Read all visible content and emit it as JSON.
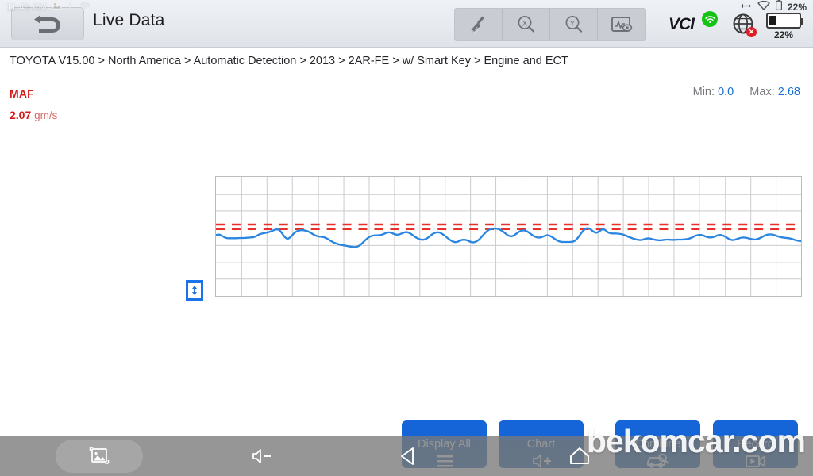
{
  "status_bar": {
    "time": "11:40 AM",
    "icons": [
      "image-icon",
      "upload-icon",
      "wifi-unknown-icon"
    ],
    "right_icons": [
      "bluetooth-transfer-icon",
      "wifi-icon",
      "battery-small-icon"
    ],
    "battery_percent_top": "22%",
    "battery_percent_bottom": "22%"
  },
  "header": {
    "title": "Live Data",
    "back_label": "back-arrow",
    "tools": [
      {
        "name": "clear-graph-icon",
        "label": "Clear"
      },
      {
        "name": "zoom-x-icon",
        "label": "X"
      },
      {
        "name": "zoom-y-icon",
        "label": "Y"
      },
      {
        "name": "graph-view-icon",
        "label": "View"
      }
    ],
    "vci_label": "VCI",
    "vci_status": "connected",
    "network_status": "disconnected"
  },
  "breadcrumb": {
    "text": "TOYOTA V15.00 > North America  > Automatic Detection  > 2013  > 2AR-FE  > w/ Smart Key  > Engine and ECT",
    "segments": [
      "TOYOTA V15.00",
      "North America",
      "Automatic Detection",
      "2013",
      "2AR-FE",
      "w/ Smart Key",
      "Engine and ECT"
    ]
  },
  "live_data": {
    "parameter_name": "MAF",
    "current_value": "2.07",
    "unit": "gm/s",
    "min_label": "Min",
    "min_value": "0.0",
    "max_label": "Max",
    "max_value": "2.68",
    "separator": ":"
  },
  "colors": {
    "parameter_red": "#d21b1b",
    "trace_blue": "#2a86e0",
    "limit_red": "#e8302b",
    "minmax_blue": "#1a6fd4",
    "button_blue": "#1565d8",
    "vci_green": "#16c216"
  },
  "chart_data": {
    "type": "line",
    "title": "MAF",
    "xlabel": "",
    "ylabel": "gm/s",
    "ylim": [
      0,
      4.5
    ],
    "grid": true,
    "legend": "none",
    "grid_cols": 23,
    "grid_rows": 7,
    "annotations": [
      {
        "type": "hline",
        "value": 2.7,
        "style": "dashed",
        "color": "#e8302b",
        "label": "upper-limit"
      },
      {
        "type": "hline",
        "value": 2.53,
        "style": "dashed",
        "color": "#e8302b",
        "label": "lower-limit"
      }
    ],
    "series": [
      {
        "name": "MAF",
        "color": "#2a86e0",
        "values": [
          2.3,
          2.33,
          2.28,
          2.21,
          2.18,
          2.18,
          2.18,
          2.18,
          2.19,
          2.19,
          2.19,
          2.2,
          2.21,
          2.22,
          2.26,
          2.33,
          2.36,
          2.38,
          2.4,
          2.44,
          2.48,
          2.52,
          2.5,
          2.36,
          2.2,
          2.15,
          2.24,
          2.36,
          2.45,
          2.48,
          2.49,
          2.47,
          2.44,
          2.38,
          2.31,
          2.26,
          2.24,
          2.23,
          2.2,
          2.14,
          2.07,
          2.01,
          1.97,
          1.94,
          1.92,
          1.9,
          1.88,
          1.86,
          1.85,
          1.86,
          1.92,
          2.02,
          2.13,
          2.22,
          2.27,
          2.29,
          2.29,
          2.3,
          2.33,
          2.38,
          2.41,
          2.38,
          2.33,
          2.31,
          2.34,
          2.39,
          2.42,
          2.39,
          2.32,
          2.24,
          2.17,
          2.13,
          2.12,
          2.16,
          2.24,
          2.33,
          2.39,
          2.41,
          2.38,
          2.31,
          2.22,
          2.13,
          2.06,
          2.03,
          2.05,
          2.11,
          2.13,
          2.11,
          2.06,
          2.02,
          2.04,
          2.1,
          2.21,
          2.34,
          2.45,
          2.52,
          2.55,
          2.55,
          2.53,
          2.48,
          2.4,
          2.31,
          2.25,
          2.26,
          2.33,
          2.42,
          2.47,
          2.48,
          2.44,
          2.36,
          2.28,
          2.22,
          2.2,
          2.22,
          2.27,
          2.3,
          2.27,
          2.2,
          2.12,
          2.06,
          2.04,
          2.04,
          2.04,
          2.04,
          2.05,
          2.12,
          2.26,
          2.42,
          2.53,
          2.57,
          2.52,
          2.42,
          2.38,
          2.44,
          2.53,
          2.5,
          2.4,
          2.36,
          2.36,
          2.36,
          2.35,
          2.33,
          2.29,
          2.24,
          2.2,
          2.16,
          2.13,
          2.11,
          2.12,
          2.16,
          2.18,
          2.16,
          2.13,
          2.11,
          2.1,
          2.11,
          2.13,
          2.13,
          2.12,
          2.12,
          2.13,
          2.13,
          2.13,
          2.14,
          2.16,
          2.2,
          2.26,
          2.3,
          2.31,
          2.29,
          2.24,
          2.21,
          2.21,
          2.24,
          2.29,
          2.31,
          2.28,
          2.22,
          2.15,
          2.11,
          2.12,
          2.16,
          2.2,
          2.21,
          2.2,
          2.17,
          2.14,
          2.13,
          2.15,
          2.2,
          2.26,
          2.31,
          2.33,
          2.32,
          2.29,
          2.25,
          2.22,
          2.2,
          2.19,
          2.18,
          2.15,
          2.11,
          2.08,
          2.07
        ]
      }
    ]
  },
  "action_buttons": [
    {
      "label": "Display All",
      "icon": "list-lines-icon"
    },
    {
      "label": "Chart",
      "icon": "speaker-plus-icon"
    },
    {
      "label": "Combine",
      "icon": "car-search-icon"
    },
    {
      "label": "Record",
      "icon": "video-camera-icon"
    }
  ],
  "nav_bar": {
    "items": [
      {
        "name": "screenshot-icon",
        "label": "Screenshot",
        "active": true
      },
      {
        "name": "volume-down-icon",
        "label": "Volume Down",
        "active": false
      },
      {
        "name": "back-triangle-icon",
        "label": "Back",
        "active": false
      },
      {
        "name": "home-icon",
        "label": "Home",
        "active": false
      }
    ]
  },
  "watermark": {
    "text": "bekomcar.com"
  }
}
